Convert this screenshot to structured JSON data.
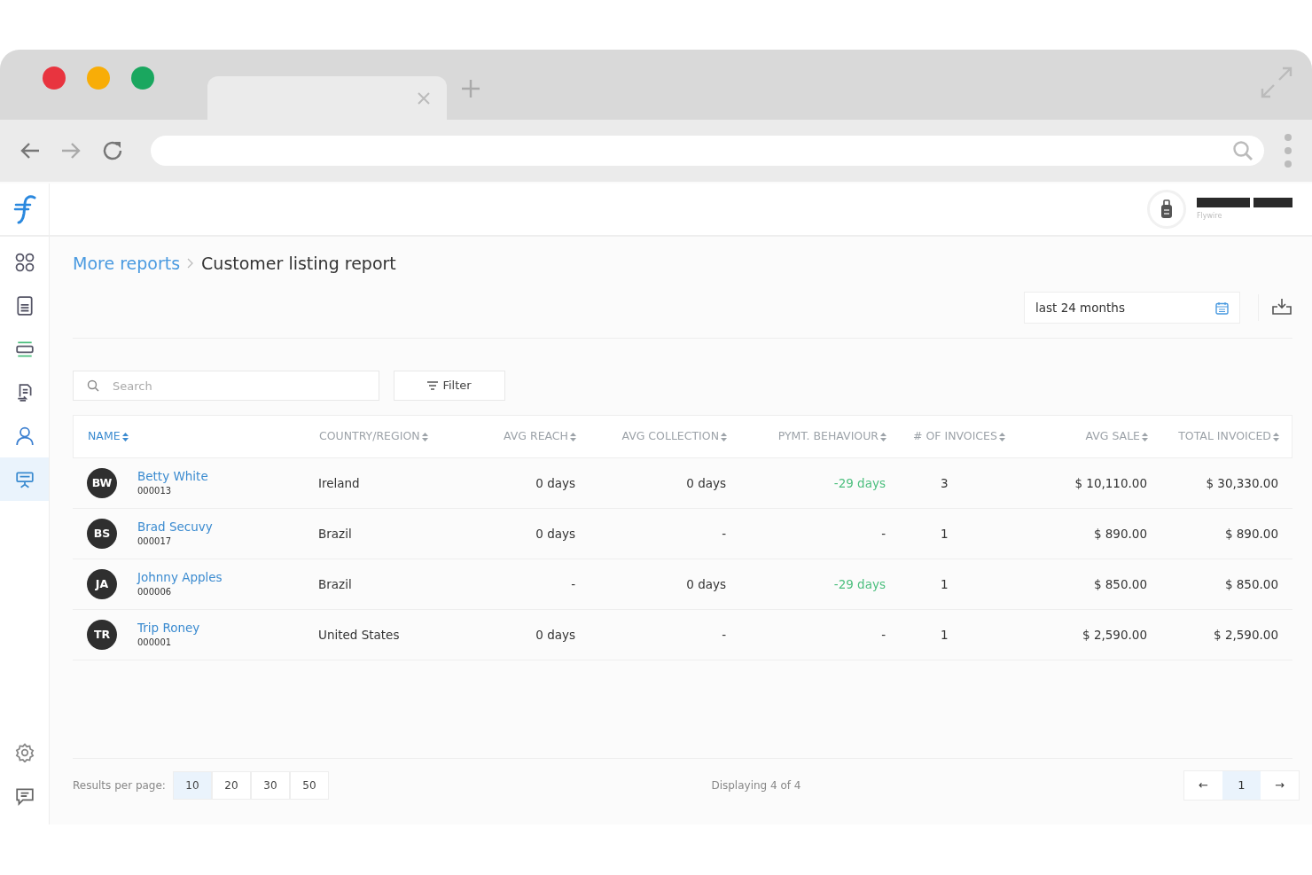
{
  "browser": {
    "tabs": [
      {
        "selected": true
      }
    ]
  },
  "header": {
    "account_label": "Flywire"
  },
  "sidebar": {
    "items": [
      {
        "kind": "grid",
        "selected": false
      },
      {
        "kind": "document",
        "selected": false
      },
      {
        "kind": "card",
        "selected": false
      },
      {
        "kind": "swap",
        "selected": false
      },
      {
        "kind": "person",
        "selected": false
      },
      {
        "kind": "board",
        "selected": true
      }
    ],
    "bottom_items": [
      {
        "kind": "gear",
        "selected": false
      },
      {
        "kind": "chat",
        "selected": false
      }
    ]
  },
  "breadcrumb": {
    "parent": "More reports",
    "current": "Customer listing report"
  },
  "date_range": {
    "value": "last 24 months"
  },
  "search": {
    "placeholder": "Search"
  },
  "filter_button": "Filter",
  "table": {
    "columns": [
      {
        "label": "NAME",
        "selected": true
      },
      {
        "label": "COUNTRY/REGION",
        "selected": false
      },
      {
        "label": "AVG REACH",
        "selected": false
      },
      {
        "label": "AVG COLLECTION",
        "selected": false
      },
      {
        "label": "PYMT. BEHAVIOUR",
        "selected": false
      },
      {
        "label": "# OF INVOICES",
        "selected": false
      },
      {
        "label": "AVG SALE",
        "selected": false
      },
      {
        "label": "TOTAL INVOICED",
        "selected": false
      }
    ],
    "rows": [
      {
        "initials": "BW",
        "name": "Betty White",
        "id": "000013",
        "country": "Ireland",
        "avg_reach": "0 days",
        "avg_collection": "0 days",
        "pymt_behaviour": {
          "text": "-29 days",
          "highlight": true
        },
        "invoices": "3",
        "avg_sale": "$ 10,110.00",
        "total_invoiced": "$ 30,330.00"
      },
      {
        "initials": "BS",
        "name": "Brad Secuvy",
        "id": "000017",
        "country": "Brazil",
        "avg_reach": "0 days",
        "avg_collection": "-",
        "pymt_behaviour": {
          "text": "-",
          "highlight": false
        },
        "invoices": "1",
        "avg_sale": "$ 890.00",
        "total_invoiced": "$ 890.00"
      },
      {
        "initials": "JA",
        "name": "Johnny Apples",
        "id": "000006",
        "country": "Brazil",
        "avg_reach": "-",
        "avg_collection": "0 days",
        "pymt_behaviour": {
          "text": "-29 days",
          "highlight": true
        },
        "invoices": "1",
        "avg_sale": "$ 850.00",
        "total_invoiced": "$ 850.00"
      },
      {
        "initials": "TR",
        "name": "Trip Roney",
        "id": "000001",
        "country": "United States",
        "avg_reach": "0 days",
        "avg_collection": "-",
        "pymt_behaviour": {
          "text": "-",
          "highlight": false
        },
        "invoices": "1",
        "avg_sale": "$ 2,590.00",
        "total_invoiced": "$ 2,590.00"
      }
    ]
  },
  "pagination": {
    "results_label": "Results per page:",
    "page_sizes": [
      {
        "label": "10",
        "selected": true
      },
      {
        "label": "20",
        "selected": false
      },
      {
        "label": "30",
        "selected": false
      },
      {
        "label": "50",
        "selected": false
      }
    ],
    "displaying": "Displaying 4 of 4",
    "prev": "←",
    "pages": [
      {
        "label": "1",
        "selected": true
      }
    ],
    "next": "→"
  }
}
